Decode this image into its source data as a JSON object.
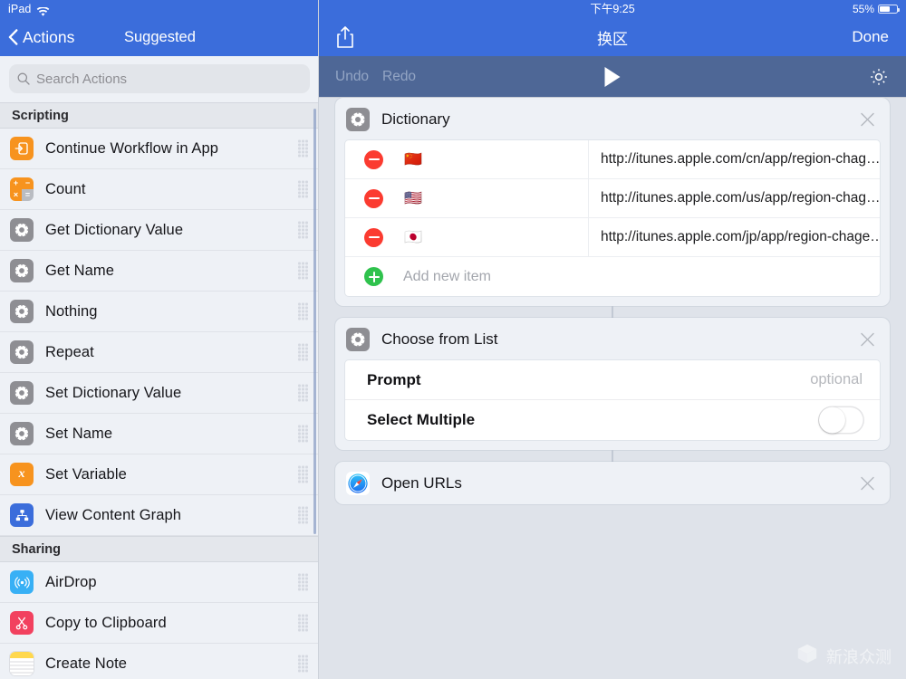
{
  "sidebar": {
    "status": {
      "device": "iPad",
      "wifi_icon": "wifi-icon"
    },
    "navbar": {
      "back_label": "Actions",
      "back_icon": "chevron-left-icon",
      "title": "Suggested"
    },
    "search": {
      "placeholder": "Search Actions",
      "icon": "search-icon"
    },
    "sections": [
      {
        "title": "Scripting",
        "items": [
          {
            "label": "Continue Workflow in App",
            "icon": "continue-workflow-icon",
            "icon_color": "#f7931e"
          },
          {
            "label": "Count",
            "icon": "calculator-icon",
            "icon_color": "#f7931e"
          },
          {
            "label": "Get Dictionary Value",
            "icon": "gear-icon",
            "icon_color": "#8e8e93"
          },
          {
            "label": "Get Name",
            "icon": "gear-icon",
            "icon_color": "#8e8e93"
          },
          {
            "label": "Nothing",
            "icon": "gear-icon",
            "icon_color": "#8e8e93"
          },
          {
            "label": "Repeat",
            "icon": "gear-icon",
            "icon_color": "#8e8e93"
          },
          {
            "label": "Set Dictionary Value",
            "icon": "gear-icon",
            "icon_color": "#8e8e93"
          },
          {
            "label": "Set Name",
            "icon": "gear-icon",
            "icon_color": "#8e8e93"
          },
          {
            "label": "Set Variable",
            "icon": "variable-x-icon",
            "icon_color": "#f7931e"
          },
          {
            "label": "View Content Graph",
            "icon": "content-graph-icon",
            "icon_color": "#3b6ddb"
          }
        ]
      },
      {
        "title": "Sharing",
        "items": [
          {
            "label": "AirDrop",
            "icon": "airdrop-icon",
            "icon_color": "#38b0f5"
          },
          {
            "label": "Copy to Clipboard",
            "icon": "scissors-icon",
            "icon_color": "#f2415f"
          },
          {
            "label": "Create Note",
            "icon": "notes-icon",
            "icon_color": "#ffd84d"
          }
        ]
      }
    ]
  },
  "pane": {
    "status": {
      "time": "下午9:25",
      "battery_percent": "55%",
      "battery_icon": "battery-icon"
    },
    "navbar": {
      "share_icon": "share-icon",
      "title": "换区",
      "done_label": "Done"
    },
    "toolbar": {
      "undo_label": "Undo",
      "redo_label": "Redo",
      "play_icon": "play-icon",
      "settings_icon": "gear-icon"
    },
    "cards": [
      {
        "id": "dictionary",
        "title": "Dictionary",
        "icon": "gear-icon",
        "close_icon": "close-icon",
        "rows": [
          {
            "remove_icon": "minus-circle-icon",
            "key": "🇨🇳",
            "value": "http://itunes.apple.com/cn/app/region-chag…"
          },
          {
            "remove_icon": "minus-circle-icon",
            "key": "🇺🇸",
            "value": "http://itunes.apple.com/us/app/region-chag…"
          },
          {
            "remove_icon": "minus-circle-icon",
            "key": "🇯🇵",
            "value": "http://itunes.apple.com/jp/app/region-chage…"
          }
        ],
        "add_row": {
          "add_icon": "plus-circle-icon",
          "label": "Add new item"
        }
      },
      {
        "id": "choose-from-list",
        "title": "Choose from List",
        "icon": "gear-icon",
        "close_icon": "close-icon",
        "properties": [
          {
            "label": "Prompt",
            "type": "text",
            "value": "",
            "placeholder": "optional"
          },
          {
            "label": "Select Multiple",
            "type": "toggle",
            "value": "off"
          }
        ]
      },
      {
        "id": "open-urls",
        "title": "Open URLs",
        "icon": "safari-icon",
        "close_icon": "close-icon"
      }
    ]
  },
  "watermark": {
    "text": "新浪众测",
    "icon": "cube-logo-icon"
  },
  "colors": {
    "accent_blue": "#3b6ddb",
    "toolbar_blue": "#4e6796",
    "canvas_bg": "#dfe3ea",
    "card_bg": "#eef1f6",
    "remove_red": "#fb3b30",
    "add_green": "#2fc24d"
  }
}
